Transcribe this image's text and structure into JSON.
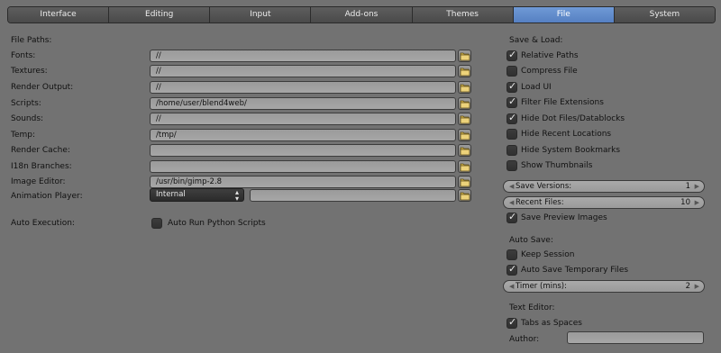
{
  "tabs": [
    {
      "label": "Interface"
    },
    {
      "label": "Editing"
    },
    {
      "label": "Input"
    },
    {
      "label": "Add-ons"
    },
    {
      "label": "Themes"
    },
    {
      "label": "File"
    },
    {
      "label": "System"
    }
  ],
  "active_tab": "File",
  "file_paths": {
    "section_title": "File Paths:",
    "fonts": {
      "label": "Fonts:",
      "value": "//"
    },
    "textures": {
      "label": "Textures:",
      "value": "//"
    },
    "render_output": {
      "label": "Render Output:",
      "value": "//"
    },
    "scripts": {
      "label": "Scripts:",
      "value": "/home/user/blend4web/"
    },
    "sounds": {
      "label": "Sounds:",
      "value": "//"
    },
    "temp": {
      "label": "Temp:",
      "value": "/tmp/"
    },
    "render_cache": {
      "label": "Render Cache:",
      "value": ""
    },
    "i18n_branches": {
      "label": "I18n Branches:",
      "value": ""
    },
    "image_editor": {
      "label": "Image Editor:",
      "value": "/usr/bin/gimp-2.8"
    },
    "animation_player": {
      "label": "Animation Player:",
      "selected": "Internal",
      "path": ""
    }
  },
  "auto_execution": {
    "label": "Auto Execution:",
    "auto_run_python": {
      "label": "Auto Run Python Scripts",
      "checked": false
    }
  },
  "save_load": {
    "title": "Save & Load:",
    "checks": [
      {
        "label": "Relative Paths",
        "checked": true
      },
      {
        "label": "Compress File",
        "checked": false
      },
      {
        "label": "Load UI",
        "checked": true
      },
      {
        "label": "Filter File Extensions",
        "checked": true
      },
      {
        "label": "Hide Dot Files/Datablocks",
        "checked": true
      },
      {
        "label": "Hide Recent Locations",
        "checked": false
      },
      {
        "label": "Hide System Bookmarks",
        "checked": false
      },
      {
        "label": "Show Thumbnails",
        "checked": false
      }
    ],
    "save_versions": {
      "label": "Save Versions:",
      "value": "1"
    },
    "recent_files": {
      "label": "Recent Files:",
      "value": "10"
    },
    "save_preview": {
      "label": "Save Preview Images",
      "checked": true
    }
  },
  "auto_save": {
    "title": "Auto Save:",
    "keep_session": {
      "label": "Keep Session",
      "checked": false
    },
    "auto_save_temp": {
      "label": "Auto Save Temporary Files",
      "checked": true
    },
    "timer": {
      "label": "Timer (mins):",
      "value": "2"
    }
  },
  "text_editor": {
    "title": "Text Editor:",
    "tabs_as_spaces": {
      "label": "Tabs as Spaces",
      "checked": true
    },
    "author": {
      "label": "Author:",
      "value": ""
    }
  },
  "icons": {
    "tick": "✓",
    "arrow_left": "◀",
    "arrow_right": "▶",
    "updown": "▴▾",
    "folder": "folder-icon"
  }
}
